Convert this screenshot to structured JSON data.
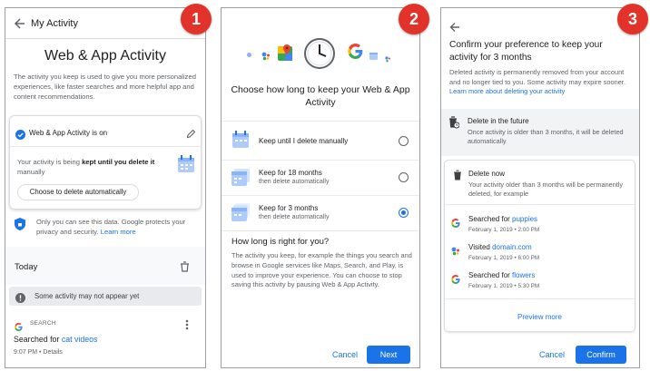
{
  "badges": [
    "1",
    "2",
    "3"
  ],
  "panel1": {
    "header_title": "My Activity",
    "page_title": "Web & App Activity",
    "intro": "The activity you keep is used to give you more personalized experiences, like faster searches and more helpful app and content recommendations.",
    "setting_label": "Web & App Activity is on",
    "kept_prefix": "Your activity is being ",
    "kept_bold": "kept until you delete it",
    "kept_suffix": " manually",
    "auto_delete_button": "Choose to delete automatically",
    "privacy_text": "Only you can see this data. Google protects your privacy and security.",
    "learn_more": "Learn more",
    "today_label": "Today",
    "notice": "Some activity may not appear yet",
    "item_source": "SEARCH",
    "item_prefix": "Searched for ",
    "item_query": "cat videos",
    "item_meta": "9:07 PM • Details"
  },
  "panel2": {
    "question": "Choose how long to keep your Web & App Activity",
    "options": [
      {
        "title": "Keep until I delete manually",
        "subtitle": ""
      },
      {
        "title": "Keep for 18 months",
        "subtitle": "then delete automatically"
      },
      {
        "title": "Keep for 3 months",
        "subtitle": "then delete automatically"
      }
    ],
    "selected_index": 2,
    "info_heading": "How long is right for you?",
    "info_body": "The activity you keep, for example the things you search and browse in Google services like Maps, Search, and Play, is used to improve your experience. You can choose to stop saving this activity by pausing Web & App Activity.",
    "cancel": "Cancel",
    "next": "Next"
  },
  "panel3": {
    "title": "Confirm your preference to keep your activity for 3 months",
    "desc": "Deleted activity is permanently removed from your account and no longer tied to you. Some activity may expire sooner.",
    "desc_link": "Learn more about deleting your activity",
    "future_title": "Delete in the future",
    "future_desc": "Once activity is older than 3 months, it will be deleted automatically",
    "now_title": "Delete now",
    "now_desc": "Your activity older than 3 months will be permanently deleted, for example",
    "items": [
      {
        "prefix": "Searched for ",
        "link": "puppies",
        "date": "February 1, 2019 • 2:00 PM"
      },
      {
        "prefix": "Visited ",
        "link": "domain.com",
        "date": "February 1, 2019 • 6:00 PM"
      },
      {
        "prefix": "Searched for ",
        "link": "flowers",
        "date": "February 1, 2019 • 5:30 PM"
      }
    ],
    "preview_more": "Preview more",
    "cancel": "Cancel",
    "confirm": "Confirm"
  },
  "colors": {
    "accent": "#1a73e8",
    "badge": "#e2332b",
    "calendar": "#aecbfa"
  }
}
